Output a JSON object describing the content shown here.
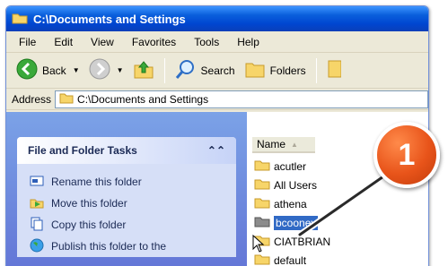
{
  "window": {
    "title": "C:\\Documents and Settings"
  },
  "menu": [
    "File",
    "Edit",
    "View",
    "Favorites",
    "Tools",
    "Help"
  ],
  "toolbar": {
    "back_label": "Back",
    "search_label": "Search",
    "folders_label": "Folders"
  },
  "address": {
    "label": "Address",
    "value": "C:\\Documents and Settings"
  },
  "tasks": {
    "title": "File and Folder Tasks",
    "items": [
      {
        "label": "Rename this folder",
        "icon": "rename-icon"
      },
      {
        "label": "Move this folder",
        "icon": "move-icon"
      },
      {
        "label": "Copy this folder",
        "icon": "copy-icon"
      },
      {
        "label": "Publish this folder to the",
        "icon": "globe-icon"
      }
    ]
  },
  "files": {
    "column": "Name",
    "items": [
      "acutler",
      "All Users",
      "athena",
      "bcooney",
      "CIATBRIAN",
      "default"
    ],
    "selected": "bcooney"
  },
  "callout": {
    "number": "1"
  },
  "colors": {
    "titlebar": "#0a5fdc",
    "callout": "#e8541a",
    "selection": "#316ac5",
    "taskpane": "#7ba2e7"
  }
}
